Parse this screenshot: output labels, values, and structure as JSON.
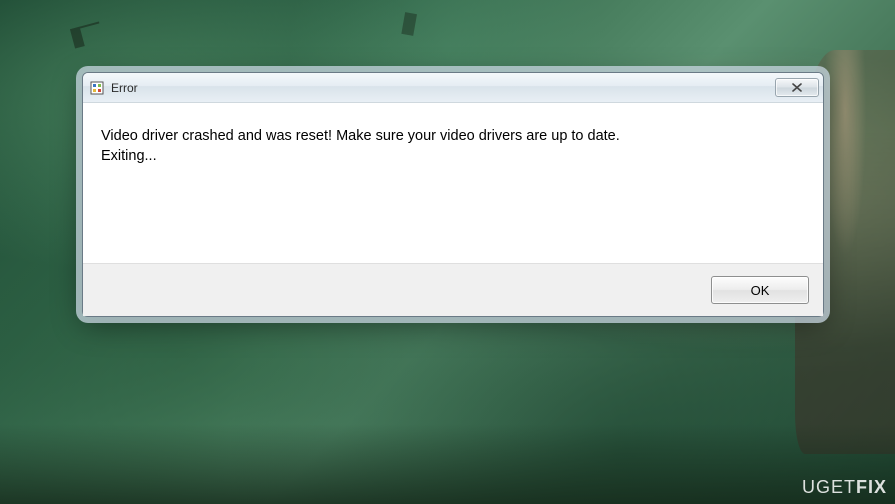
{
  "dialog": {
    "title": "Error",
    "message": "Video driver crashed and was reset!  Make sure your video drivers are up to date.\nExiting...",
    "ok_label": "OK"
  },
  "watermark": {
    "brand_pre": "UGET",
    "brand_post": "FIX"
  }
}
